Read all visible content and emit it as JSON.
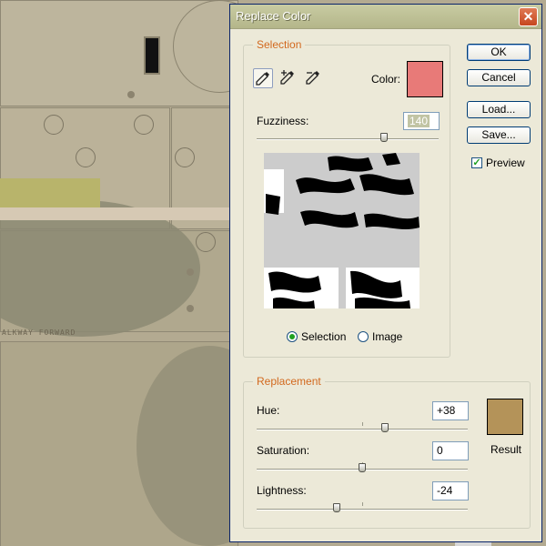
{
  "dialog": {
    "title": "Replace Color",
    "close_symbol": "✕"
  },
  "selection_group": {
    "label": "Selection",
    "color_label": "Color:",
    "color_swatch": "#e87a78",
    "fuzziness_label": "Fuzziness:",
    "fuzziness_value": "140",
    "fuzziness_fraction": 0.7
  },
  "view_mode": {
    "selection_label": "Selection",
    "image_label": "Image",
    "selected": "Selection"
  },
  "buttons": {
    "ok": "OK",
    "cancel": "Cancel",
    "load": "Load...",
    "save": "Save..."
  },
  "preview": {
    "label": "Preview",
    "checked": true
  },
  "replacement_group": {
    "label": "Replacement",
    "hue_label": "Hue:",
    "hue_value": "+38",
    "saturation_label": "Saturation:",
    "saturation_value": "0",
    "lightness_label": "Lightness:",
    "lightness_value": "-24",
    "result_label": "Result",
    "result_swatch": "#b49359"
  },
  "background": {
    "stencil_text": "ALKWAY FORWARD"
  },
  "icons": [
    "eyedropper-icon",
    "eyedropper-plus-icon",
    "eyedropper-minus-icon",
    "close-icon",
    "check-icon"
  ]
}
